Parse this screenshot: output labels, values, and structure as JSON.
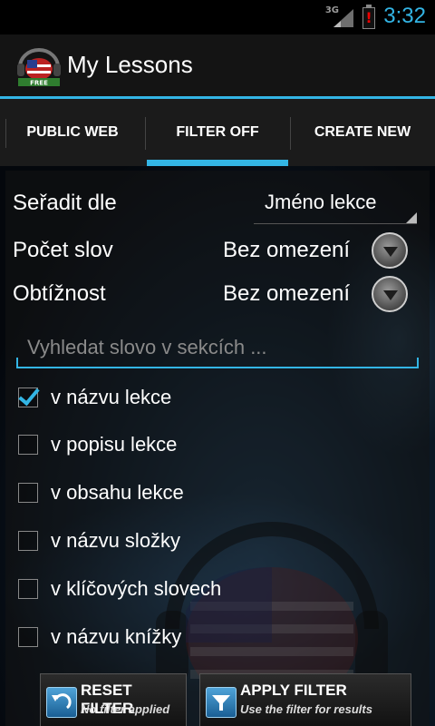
{
  "status": {
    "network": "3G",
    "clock": "3:32"
  },
  "header": {
    "title": "My Lessons",
    "icon_badge": "FREE"
  },
  "tabs": [
    {
      "label": "PUBLIC WEB"
    },
    {
      "label": "FILTER OFF"
    },
    {
      "label": "CREATE NEW"
    }
  ],
  "filter": {
    "sort": {
      "label": "Seřadit dle",
      "value": "Jméno lekce"
    },
    "word_count": {
      "label": "Počet slov",
      "value": "Bez omezení"
    },
    "difficulty": {
      "label": "Obtížnost",
      "value": "Bez omezení"
    },
    "search_placeholder": "Vyhledat slovo v sekcích ...",
    "options": [
      {
        "label": "v názvu lekce",
        "checked": true
      },
      {
        "label": "v popisu lekce",
        "checked": false
      },
      {
        "label": "v obsahu lekce",
        "checked": false
      },
      {
        "label": "v názvu složky",
        "checked": false
      },
      {
        "label": "v klíčových slovech",
        "checked": false
      },
      {
        "label": "v názvu knížky",
        "checked": false
      }
    ]
  },
  "buttons": {
    "reset": {
      "title": "RESET FILTER",
      "subtitle": "No filter applied"
    },
    "apply": {
      "title": "APPLY FILTER",
      "subtitle": "Use the filter for results"
    }
  },
  "colors": {
    "accent": "#33b5e5",
    "background": "#000000"
  }
}
